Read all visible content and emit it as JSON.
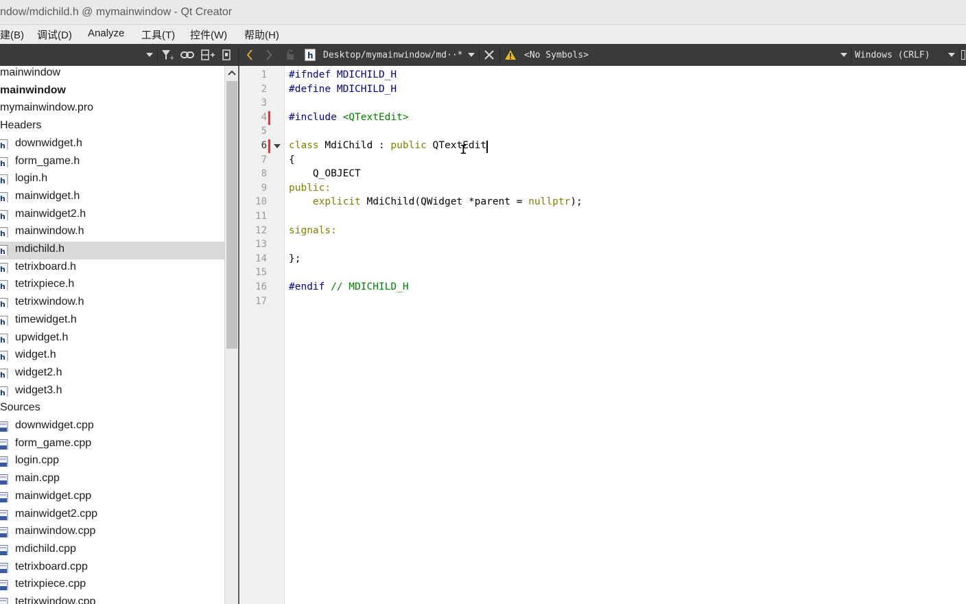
{
  "window": {
    "title": "ndow/mdichild.h @ mymainwindow - Qt Creator"
  },
  "menu": [
    "建(B)",
    "调试(D)",
    "Analyze",
    "工具(T)",
    "控件(W)",
    "帮助(H)"
  ],
  "toolbar": {
    "file_path": "Desktop/mymainwindow/md··*",
    "symbols": "<No Symbols>",
    "line_ending": "Windows (CRLF)",
    "file_type_glyph": "h"
  },
  "project_tree": {
    "items": [
      {
        "label": "mainwindow",
        "level": 0,
        "icon": "none",
        "bold": false
      },
      {
        "label": "mainwindow",
        "level": 0,
        "icon": "none",
        "bold": true
      },
      {
        "label": "mymainwindow.pro",
        "level": 0,
        "icon": "none",
        "bold": false
      },
      {
        "label": "Headers",
        "level": 0,
        "icon": "none",
        "bold": false
      },
      {
        "label": "downwidget.h",
        "level": 1,
        "icon": "header-file-icon",
        "bold": false
      },
      {
        "label": "form_game.h",
        "level": 1,
        "icon": "header-file-icon",
        "bold": false
      },
      {
        "label": "login.h",
        "level": 1,
        "icon": "header-file-icon",
        "bold": false
      },
      {
        "label": "mainwidget.h",
        "level": 1,
        "icon": "header-file-icon",
        "bold": false
      },
      {
        "label": "mainwidget2.h",
        "level": 1,
        "icon": "header-file-icon",
        "bold": false
      },
      {
        "label": "mainwindow.h",
        "level": 1,
        "icon": "header-file-icon",
        "bold": false
      },
      {
        "label": "mdichild.h",
        "level": 1,
        "icon": "header-file-icon",
        "bold": false,
        "selected": true
      },
      {
        "label": "tetrixboard.h",
        "level": 1,
        "icon": "header-file-icon",
        "bold": false
      },
      {
        "label": "tetrixpiece.h",
        "level": 1,
        "icon": "header-file-icon",
        "bold": false
      },
      {
        "label": "tetrixwindow.h",
        "level": 1,
        "icon": "header-file-icon",
        "bold": false
      },
      {
        "label": "timewidget.h",
        "level": 1,
        "icon": "header-file-icon",
        "bold": false
      },
      {
        "label": "upwidget.h",
        "level": 1,
        "icon": "header-file-icon",
        "bold": false
      },
      {
        "label": "widget.h",
        "level": 1,
        "icon": "header-file-icon",
        "bold": false
      },
      {
        "label": "widget2.h",
        "level": 1,
        "icon": "header-file-icon",
        "bold": false
      },
      {
        "label": "widget3.h",
        "level": 1,
        "icon": "header-file-icon",
        "bold": false
      },
      {
        "label": "Sources",
        "level": 0,
        "icon": "none",
        "bold": false
      },
      {
        "label": "downwidget.cpp",
        "level": 1,
        "icon": "cpp-file-icon",
        "bold": false
      },
      {
        "label": "form_game.cpp",
        "level": 1,
        "icon": "cpp-file-icon",
        "bold": false
      },
      {
        "label": "login.cpp",
        "level": 1,
        "icon": "cpp-file-icon",
        "bold": false
      },
      {
        "label": "main.cpp",
        "level": 1,
        "icon": "cpp-file-icon",
        "bold": false
      },
      {
        "label": "mainwidget.cpp",
        "level": 1,
        "icon": "cpp-file-icon",
        "bold": false
      },
      {
        "label": "mainwidget2.cpp",
        "level": 1,
        "icon": "cpp-file-icon",
        "bold": false
      },
      {
        "label": "mainwindow.cpp",
        "level": 1,
        "icon": "cpp-file-icon",
        "bold": false
      },
      {
        "label": "mdichild.cpp",
        "level": 1,
        "icon": "cpp-file-icon",
        "bold": false
      },
      {
        "label": "tetrixboard.cpp",
        "level": 1,
        "icon": "cpp-file-icon",
        "bold": false
      },
      {
        "label": "tetrixpiece.cpp",
        "level": 1,
        "icon": "cpp-file-icon",
        "bold": false
      },
      {
        "label": "tetrixwindow.cpp",
        "level": 1,
        "icon": "cpp-file-icon",
        "bold": false
      }
    ]
  },
  "editor": {
    "current_line": 6,
    "changed_lines": [
      4,
      6
    ],
    "lines": [
      [
        {
          "t": "#ifndef MDICHILD_H",
          "c": "pp"
        }
      ],
      [
        {
          "t": "#define MDICHILD_H",
          "c": "pp"
        }
      ],
      [],
      [
        {
          "t": "#include ",
          "c": "pp"
        },
        {
          "t": "<QTextEdit>",
          "c": "str"
        }
      ],
      [],
      [
        {
          "t": "class",
          "c": "kw"
        },
        {
          "t": " MdiChild : ",
          "c": "mac"
        },
        {
          "t": "public",
          "c": "kw"
        },
        {
          "t": " QTextEdit",
          "c": "mac"
        }
      ],
      [
        {
          "t": "{",
          "c": "mac"
        }
      ],
      [
        {
          "t": "    Q_OBJECT",
          "c": "mac"
        }
      ],
      [
        {
          "t": "public:",
          "c": "kw"
        }
      ],
      [
        {
          "t": "    ",
          "c": "mac"
        },
        {
          "t": "explicit",
          "c": "kw"
        },
        {
          "t": " MdiChild(QWidget *parent = ",
          "c": "mac"
        },
        {
          "t": "nullptr",
          "c": "kw"
        },
        {
          "t": ");",
          "c": "mac"
        }
      ],
      [],
      [
        {
          "t": "signals:",
          "c": "kw"
        }
      ],
      [],
      [
        {
          "t": "};",
          "c": "mac"
        }
      ],
      [],
      [
        {
          "t": "#endif ",
          "c": "pp"
        },
        {
          "t": "// MDICHILD_H",
          "c": "cmt"
        }
      ],
      []
    ]
  }
}
